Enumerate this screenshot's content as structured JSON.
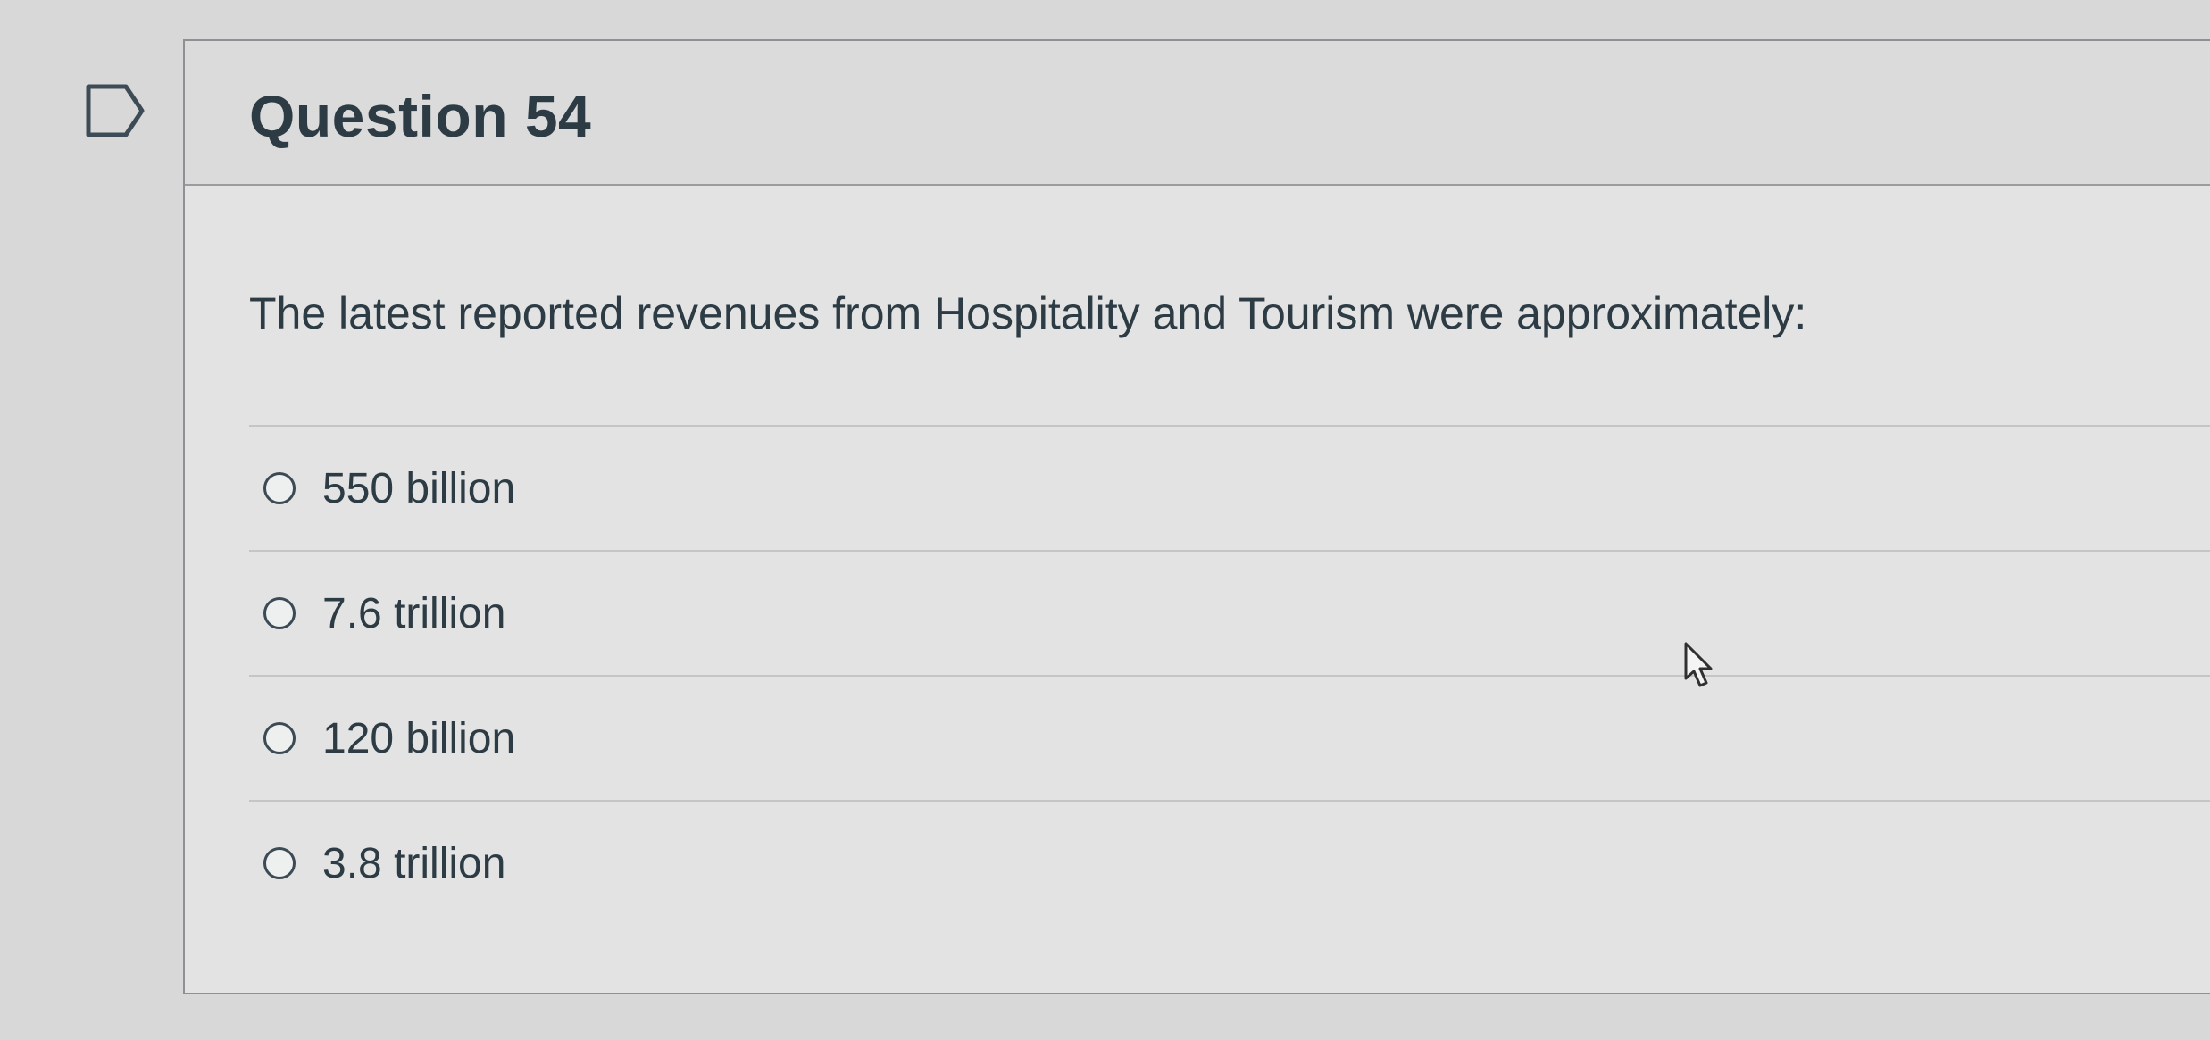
{
  "question": {
    "title": "Question 54",
    "text": "The latest reported revenues from Hospitality and Tourism were approximately:",
    "flag_icon": "bookmark-flag-icon",
    "answers": [
      {
        "label": "550 billion",
        "selected": false
      },
      {
        "label": "7.6 trillion",
        "selected": false
      },
      {
        "label": "120 billion",
        "selected": false
      },
      {
        "label": "3.8 trillion",
        "selected": false
      }
    ]
  },
  "cursor_icon": "mouse-pointer-icon",
  "colors": {
    "background": "#d7d8d7",
    "card": "#e2e3e2",
    "header": "#dadbda",
    "text": "#2d3b45",
    "border": "#8e9093"
  }
}
